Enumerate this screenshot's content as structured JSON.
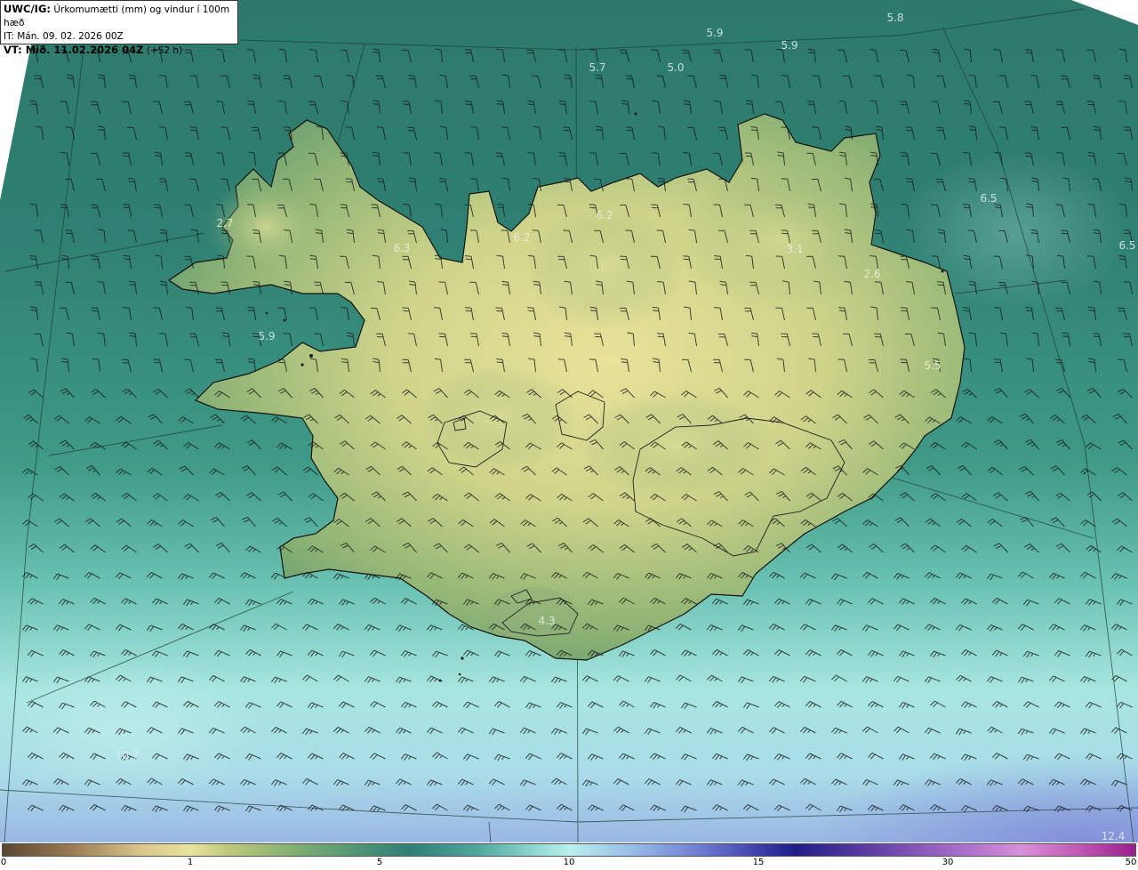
{
  "header": {
    "product": "UWC/IG:",
    "description": "Úrkomumætti (mm) og vindur í 100m hæð",
    "init_time": "IT: Mán. 09. 02. 2026 00Z",
    "valid_label": "VT: Mið. 11.02.2026 04Z",
    "valid_offset": "(+52 h)"
  },
  "map": {
    "type": "weather-map",
    "region": "Iceland",
    "field": "precipitable water",
    "overlay": "wind barbs at 100 m",
    "colors": {
      "sea_north": "#2f7e70",
      "sea_south": "#a6e6e2",
      "land_high": "#e6e098",
      "land_mid": "#a9be78",
      "coastline": "#111111",
      "barbs": "#1a1a1a"
    },
    "value_labels": [
      "5.8",
      "5.9",
      "5.9",
      "5.7",
      "5.0",
      "6.5",
      "6.5",
      "6.2",
      "6.2",
      "6.3",
      "2.7",
      "3.1",
      "2.6",
      "5.9",
      "5.5",
      "4.3",
      "10.7",
      "12.4"
    ]
  },
  "colorbar": {
    "ticks": [
      "0",
      "1",
      "5",
      "10",
      "15",
      "30",
      "50"
    ]
  }
}
